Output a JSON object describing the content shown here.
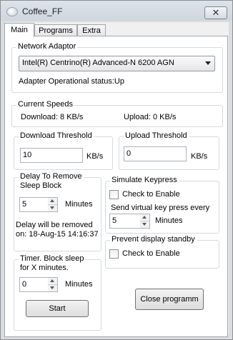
{
  "window": {
    "title": "Coffee_FF",
    "close_glyph": "✕"
  },
  "tabs": [
    {
      "label": "Main"
    },
    {
      "label": "Programs"
    },
    {
      "label": "Extra"
    }
  ],
  "network": {
    "title": "Network Adaptor",
    "selected": "Intel(R) Centrino(R) Advanced-N 6200 AGN",
    "status": "Adapter Operational status:Up"
  },
  "speeds": {
    "title": "Current Speeds",
    "download": "Download: 8 KB/s",
    "upload": "Upload: 0 KB/s"
  },
  "download_threshold": {
    "title": "Download Threshold",
    "value": "10",
    "unit": "KB/s"
  },
  "upload_threshold": {
    "title": "Upload Threshold",
    "value": "0",
    "unit": "KB/s"
  },
  "delay": {
    "title_line1": "Delay To Remove",
    "title_line2": "Sleep Block",
    "value": "5",
    "unit": "Minutes",
    "info_line1": "Delay will be removed",
    "info_line2": "on: 18-Aug-15 14:16:37"
  },
  "simulate": {
    "title": "Simulate Keypress",
    "check_label": "Check to Enable",
    "send_label": "Send virtual key press every",
    "value": "5",
    "unit": "Minutes"
  },
  "prevent": {
    "title": "Prevent display standby",
    "check_label": "Check to Enable"
  },
  "timer": {
    "title_line1": "Timer. Block sleep",
    "title_line2": "for X minutes.",
    "value": "0",
    "unit": "Minutes",
    "start_label": "Start"
  },
  "close_program_label": "Close programm"
}
